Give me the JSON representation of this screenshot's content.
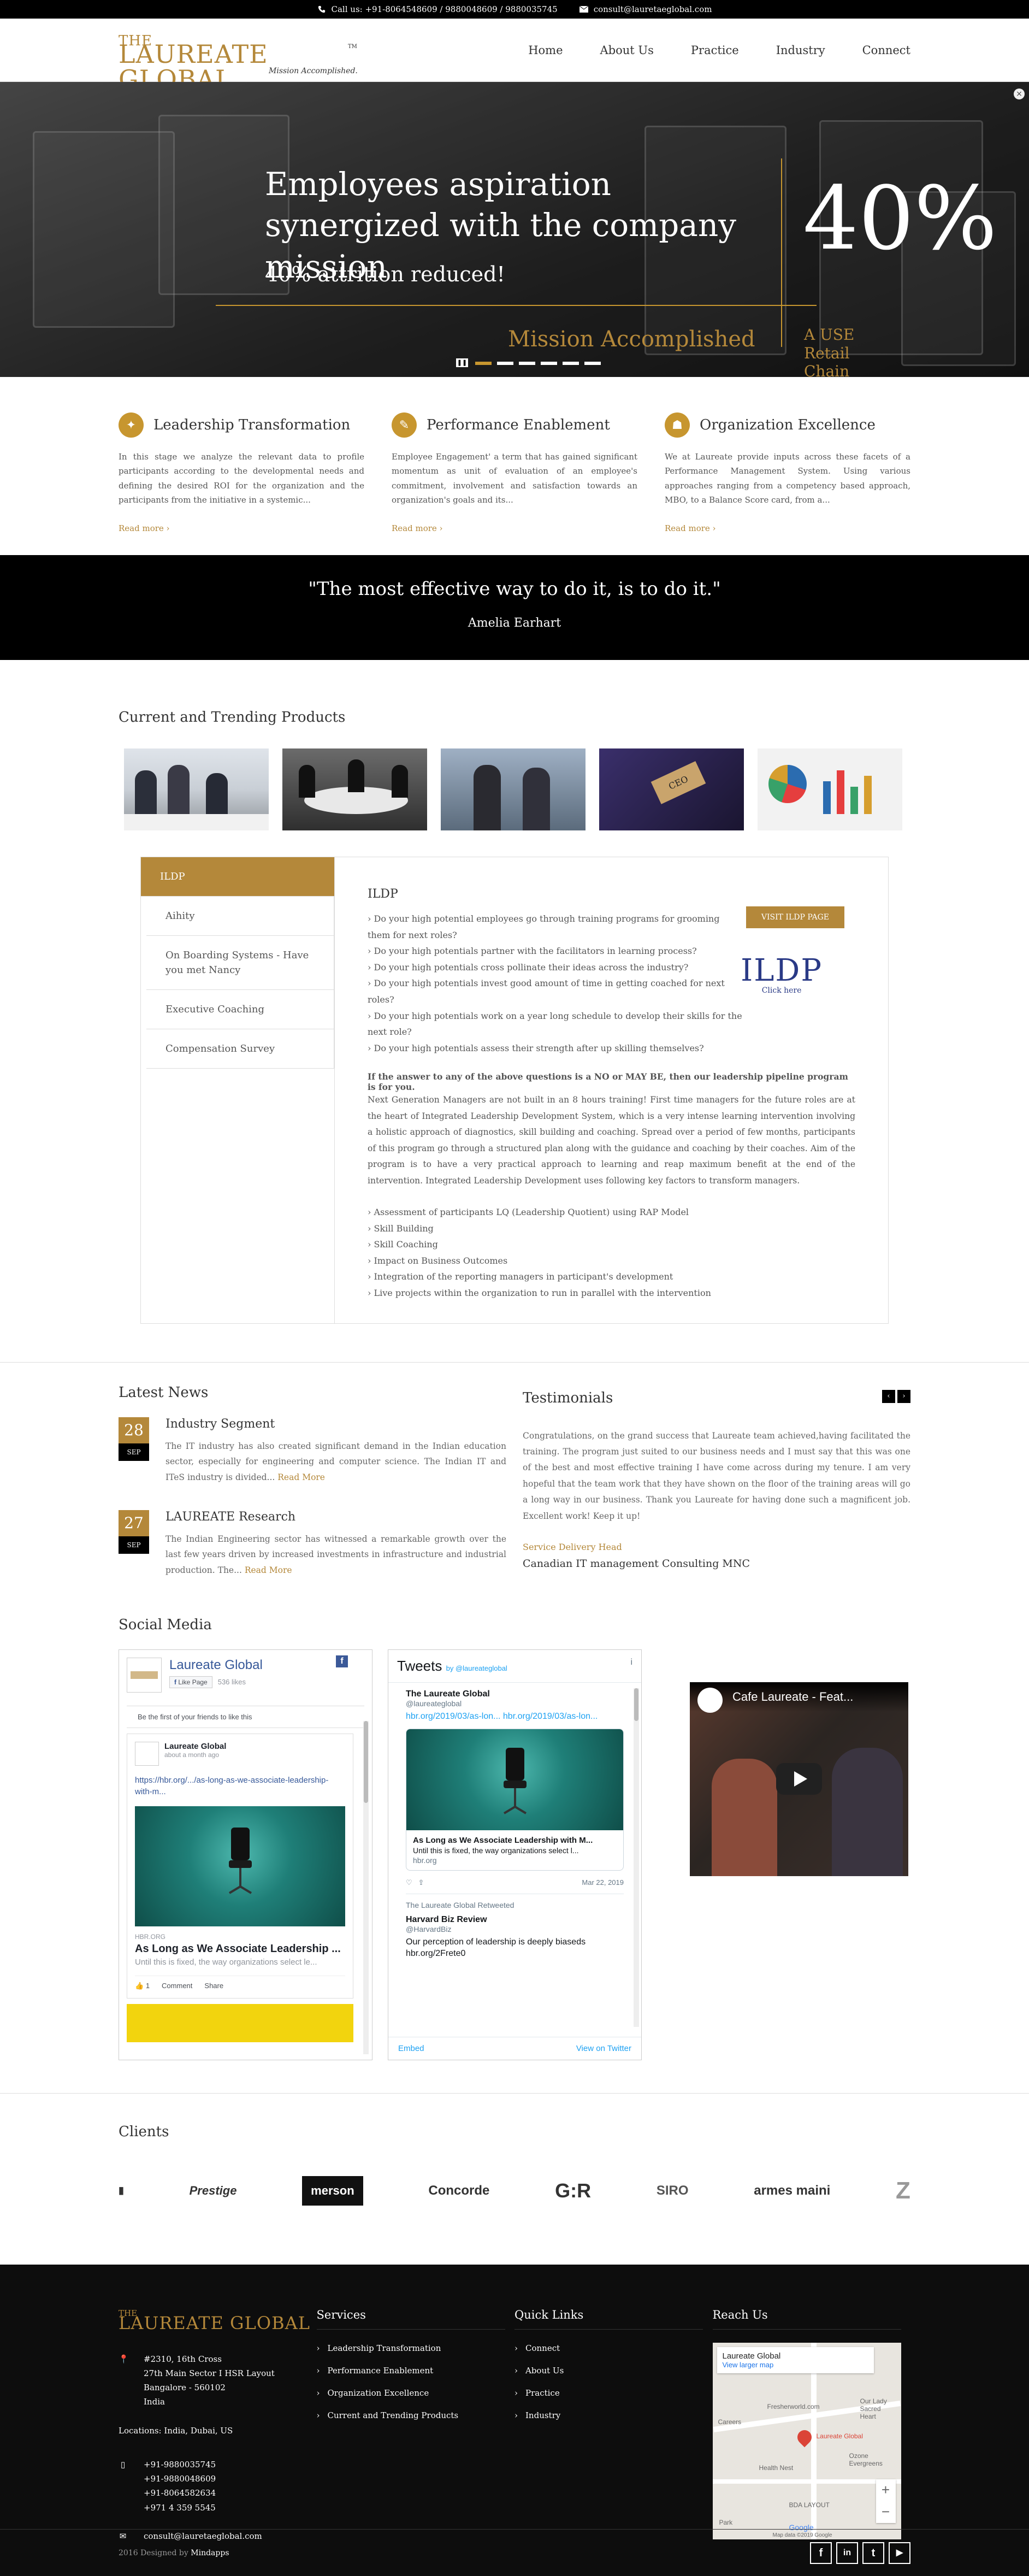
{
  "topbar": {
    "call": "Call us: +91-8064548609 / 9880048609 / 9880035745",
    "email": "consult@lauretaeglobal.com"
  },
  "logo": {
    "the": "THE",
    "name": "LAUREATE GLOBAL",
    "tagline": "Mission Accomplished.",
    "tm": "TM"
  },
  "nav": [
    "Home",
    "About Us",
    "Practice",
    "Industry",
    "Connect"
  ],
  "hero": {
    "headline": "Employees aspiration synergized with the company mission",
    "sub": "40% attrition reduced!",
    "big": "40%",
    "mission": "Mission Accomplished",
    "client": "A USE Retail Chain",
    "slides": 6,
    "active": 0,
    "close": "×"
  },
  "features": [
    {
      "icon": "leadership-icon",
      "title": "Leadership Transformation",
      "text": "In this stage we analyze the relevant data to profile participants according to the developmental needs and defining the desired ROI for the organization and the participants from the initiative in a systemic...",
      "more": "Read more ›"
    },
    {
      "icon": "performance-icon",
      "title": "Performance Enablement",
      "text": "Employee Engagement' a term that has gained significant momentum as unit of evaluation of an employee's commitment, involvement and satisfaction towards an organization's goals and its...",
      "more": "Read more ›"
    },
    {
      "icon": "excellence-icon",
      "title": "Organization Excellence",
      "text": "We at Laureate provide inputs across these facets of a Performance Management System. Using various approaches ranging from a competency based approach, MBO, to a Balance Score card, from a...",
      "more": "Read more ›"
    }
  ],
  "quote": {
    "text": "\"The most effective way to do it, is to do it.\"",
    "author": "Amelia Earhart"
  },
  "products": {
    "title": "Current and Trending Products",
    "tabs": [
      "ILDP",
      "Aihity",
      "On Boarding Systems - Have you met Nancy",
      "Executive Coaching",
      "Compensation Survey"
    ],
    "active_title": "ILDP",
    "questions": [
      "› Do your high potential employees go through training programs for grooming them for next roles?",
      "› Do your high potentials partner with the facilitators in learning process?",
      "› Do your high potentials cross pollinate their ideas across the industry?",
      "› Do your high potentials invest good amount of time in getting coached for next roles?",
      "› Do your high potentials work on a year long schedule to develop their skills for the next role?",
      "› Do your high potentials assess their strength after up skilling themselves?"
    ],
    "bold": "If the answer to any of the above questions is a NO or MAY BE, then our leadership pipeline program is for you.",
    "para": "Next Generation Managers are not built in an 8 hours training! First time managers for the future roles are at the heart of Integrated Leadership Development System, which is a very intense learning intervention involving a holistic approach of diagnostics, skill building and coaching. Spread over a period of few months, participants of this program go through a structured plan along with the guidance and coaching by their coaches. Aim of the program is to have a very practical approach to learning and reap maximum benefit at the end of the intervention. Integrated Leadership Development uses following key factors to transform managers.",
    "factors": [
      "› Assessment of participants LQ (Leadership Quotient) using RAP Model",
      "› Skill Building",
      "› Skill Coaching",
      "› Impact on Business Outcomes",
      "› Integration of the reporting managers in participant's development",
      "› Live projects within the organization to run in parallel with the intervention"
    ],
    "visit": "VISIT ILDP PAGE",
    "ildp_logo": "ILDP",
    "ildp_click": "Click here"
  },
  "news": {
    "title": "Latest News",
    "items": [
      {
        "day": "28",
        "month": "SEP",
        "title": "Industry Segment",
        "text": "The IT industry has also created significant demand in the Indian education sector, especially for engineering and computer science. The Indian IT and ITeS industry is divided...",
        "more": "Read More"
      },
      {
        "day": "27",
        "month": "SEP",
        "title": "LAUREATE Research",
        "text": "The Indian Engineering sector has witnessed a remarkable growth over the last few years driven by increased investments in infrastructure and industrial production. The...",
        "more": "Read More"
      }
    ]
  },
  "testimonials": {
    "title": "Testimonials",
    "text": "Congratulations, on the grand success that Laureate team achieved,having facilitated the training. The program just suited to our business needs and I must say that this was one of the best and most effective training I have come across during my tenure. I am very hopeful that the team work that they have shown on the floor of the training areas will go a long way in our business. Thank you Laureate for having done such a magnificent job. Excellent work! Keep it up!",
    "who": "Service Delivery Head",
    "company": "Canadian IT management Consulting MNC",
    "prev": "‹",
    "next": "›"
  },
  "social": {
    "title": "Social Media",
    "fb": {
      "name": "Laureate Global",
      "like": "Like Page",
      "likes": "536 likes",
      "first": "Be the first of your friends to like this",
      "post_author": "Laureate Global",
      "post_time": "about a month ago",
      "post_link": "https://hbr.org/.../as-long-as-we-associate-leadership-with-m...",
      "source": "HBR.ORG",
      "post_title": "As Long as We Associate Leadership ...",
      "post_desc": "Until this is fixed, the way organizations select le...",
      "like_btn": "1",
      "comment": "Comment",
      "share": "Share"
    },
    "tw": {
      "title": "Tweets",
      "by": "by @laureateglobal",
      "info": "i",
      "user": "The Laureate Global",
      "handle": "@laureateglobal",
      "tweet": "hbr.org/2019/03/as-lon... hbr.org/2019/03/as-lon...",
      "card_title": "As Long as We Associate Leadership with M...",
      "card_desc": "Until this is fixed, the way organizations select l...",
      "card_url": "hbr.org",
      "date": "Mar 22, 2019",
      "retweet": "The Laureate Global Retweeted",
      "user2": "Harvard Biz Review",
      "handle2": "@HarvardBiz",
      "tweet2": "Our perception of leadership is deeply biaseds hbr.org/2Frete0",
      "embed": "Embed",
      "view": "View on Twitter"
    },
    "yt": {
      "title": "Cafe Laureate - Feat..."
    }
  },
  "clients": {
    "title": "Clients",
    "list": [
      "Prestige",
      "merson",
      "Concorde",
      "G:R",
      "SIRO",
      "armes maini",
      "Z"
    ]
  },
  "footer": {
    "logo_the": "THE",
    "logo_name": "LAUREATE GLOBAL",
    "address": [
      "#2310, 16th Cross",
      "27th Main Sector I HSR Layout",
      "Bangalore - 560102",
      "India"
    ],
    "locations": "Locations: India, Dubai, US",
    "phones": [
      "+91-9880035745",
      "+91-9880048609",
      "+91-8064582634",
      "+971 4 359 5545"
    ],
    "email": "consult@lauretaeglobal.com",
    "services_title": "Services",
    "services": [
      "Leadership Transformation",
      "Performance Enablement",
      "Organization Excellence",
      "Current and Trending Products"
    ],
    "quick_title": "Quick Links",
    "quick": [
      "Connect",
      "About Us",
      "Practice",
      "Industry"
    ],
    "reach_title": "Reach Us",
    "map": {
      "name": "Laureate Global",
      "view": "View larger map",
      "pin": "Laureate Global",
      "labels": [
        "Careers",
        "Fresherworld.com",
        "Health Nest",
        "BDA LAYOUT",
        "Our Lady Sacred Heart",
        "Ozone Evergreens",
        "Park"
      ],
      "google": "Google",
      "attrib": "Map data ©2019 Google"
    },
    "copyright": "2016 Designed by",
    "designer": "Mindapps",
    "social": [
      "f",
      "in",
      "t",
      "▶"
    ]
  }
}
